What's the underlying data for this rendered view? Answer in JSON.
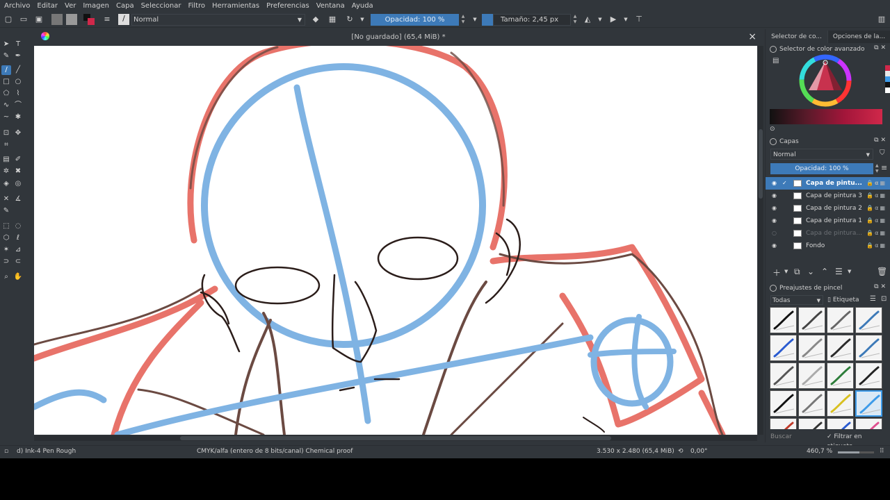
{
  "menu": [
    "Archivo",
    "Editar",
    "Ver",
    "Imagen",
    "Capa",
    "Seleccionar",
    "Filtro",
    "Herramientas",
    "Preferencias",
    "Ventana",
    "Ayuda"
  ],
  "toolbar": {
    "blend_mode": "Normal",
    "opacity_label": "Opacidad: 100 %",
    "size_label": "Tamaño: 2,45 px",
    "opacity_fill": 1.0
  },
  "document": {
    "title": "[No guardado]  (65,4 MiB) *",
    "close": "×"
  },
  "dock": {
    "tabs": [
      "Selector de co...",
      "Opciones de la..."
    ],
    "color_panel_title": "Selector de color avanzado",
    "layers_title": "Capas",
    "layers_blend": "Normal",
    "layers_opacity": "Opacidad:  100 %",
    "layers": [
      {
        "name": "Capa de pintu...",
        "active": true,
        "visible": true
      },
      {
        "name": "Capa de pintura 3",
        "active": false,
        "visible": true
      },
      {
        "name": "Capa de pintura 2",
        "active": false,
        "visible": true
      },
      {
        "name": "Capa de pintura 1",
        "active": false,
        "visible": true
      },
      {
        "name": "Capa de pintura...",
        "active": false,
        "visible": false
      },
      {
        "name": "Fondo",
        "active": false,
        "visible": true
      }
    ],
    "brushes_title": "Preajustes de pincel",
    "brush_filter": "Todas",
    "brush_tag": "Etiqueta",
    "brush_search": "Buscar",
    "brush_filter_tag": "Filtrar en etiqueta"
  },
  "status": {
    "brush": "d) Ink-4 Pen Rough",
    "colorspace": "CMYK/alfa (entero de 8 bits/canal)  Chemical proof",
    "image_size": "3.530 x 2.480 (65,4 MiB)",
    "rotation": "0,00°",
    "zoom": "460,7 %"
  },
  "colors": {
    "accent": "#3d7ab8",
    "bg": "#31363b",
    "sketch_red": "#e8736a",
    "sketch_blue": "#7fb3e3",
    "ink": "#4a3a36"
  }
}
